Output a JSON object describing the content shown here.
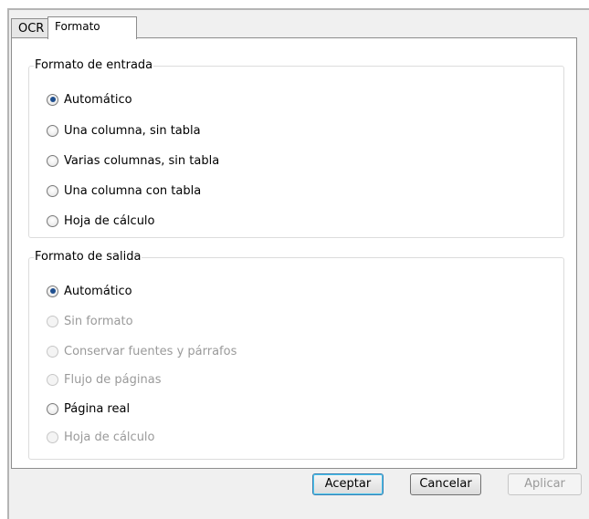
{
  "tabs": [
    {
      "label": "OCR"
    },
    {
      "label": "Formato"
    }
  ],
  "input_group": {
    "title": "Formato de entrada",
    "options": [
      {
        "label": "Automático",
        "checked": true,
        "enabled": true
      },
      {
        "label": "Una columna, sin tabla",
        "checked": false,
        "enabled": true
      },
      {
        "label": "Varias columnas, sin tabla",
        "checked": false,
        "enabled": true
      },
      {
        "label": "Una columna con tabla",
        "checked": false,
        "enabled": true
      },
      {
        "label": "Hoja de cálculo",
        "checked": false,
        "enabled": true
      }
    ]
  },
  "output_group": {
    "title": "Formato de salida",
    "options": [
      {
        "label": "Automático",
        "checked": true,
        "enabled": true
      },
      {
        "label": "Sin formato",
        "checked": false,
        "enabled": false
      },
      {
        "label": "Conservar fuentes y párrafos",
        "checked": false,
        "enabled": false
      },
      {
        "label": "Flujo de páginas",
        "checked": false,
        "enabled": false
      },
      {
        "label": "Página real",
        "checked": false,
        "enabled": true
      },
      {
        "label": "Hoja de cálculo",
        "checked": false,
        "enabled": false
      }
    ]
  },
  "buttons": {
    "ok": "Aceptar",
    "cancel": "Cancelar",
    "apply": "Aplicar"
  }
}
